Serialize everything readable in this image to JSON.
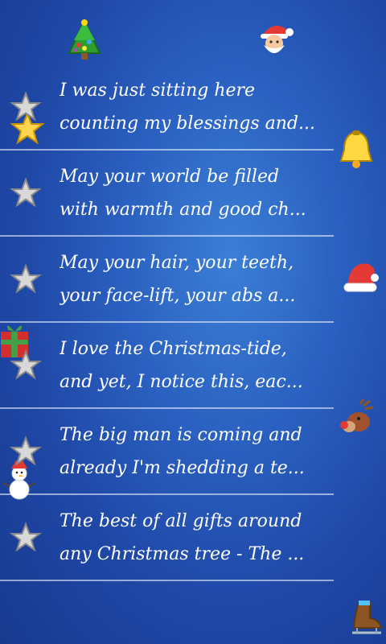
{
  "messages": [
    {
      "line1": "I was just sitting here",
      "line2": "counting my blessings and..."
    },
    {
      "line1": "May your world be filled",
      "line2": "with warmth and good ch..."
    },
    {
      "line1": "May your hair, your teeth,",
      "line2": "your face-lift, your abs a..."
    },
    {
      "line1": "I love the Christmas-tide,",
      "line2": "and yet, I notice this, eac..."
    },
    {
      "line1": "The big man is coming and",
      "line2": "already I'm shedding a te..."
    },
    {
      "line1": "The best of all gifts around",
      "line2": "any Christmas tree - The ..."
    }
  ],
  "icons": {
    "favorite_star": "star-outline-icon",
    "decorations": [
      "christmas-tree-icon",
      "santa-icon",
      "gold-star-icon",
      "bell-icon",
      "santa-hat-icon",
      "gift-icon",
      "reindeer-icon",
      "snowman-icon",
      "skate-icon"
    ]
  },
  "colors": {
    "background": "#2a5fbf",
    "text": "#ffffff",
    "divider": "#cfd9f2"
  }
}
